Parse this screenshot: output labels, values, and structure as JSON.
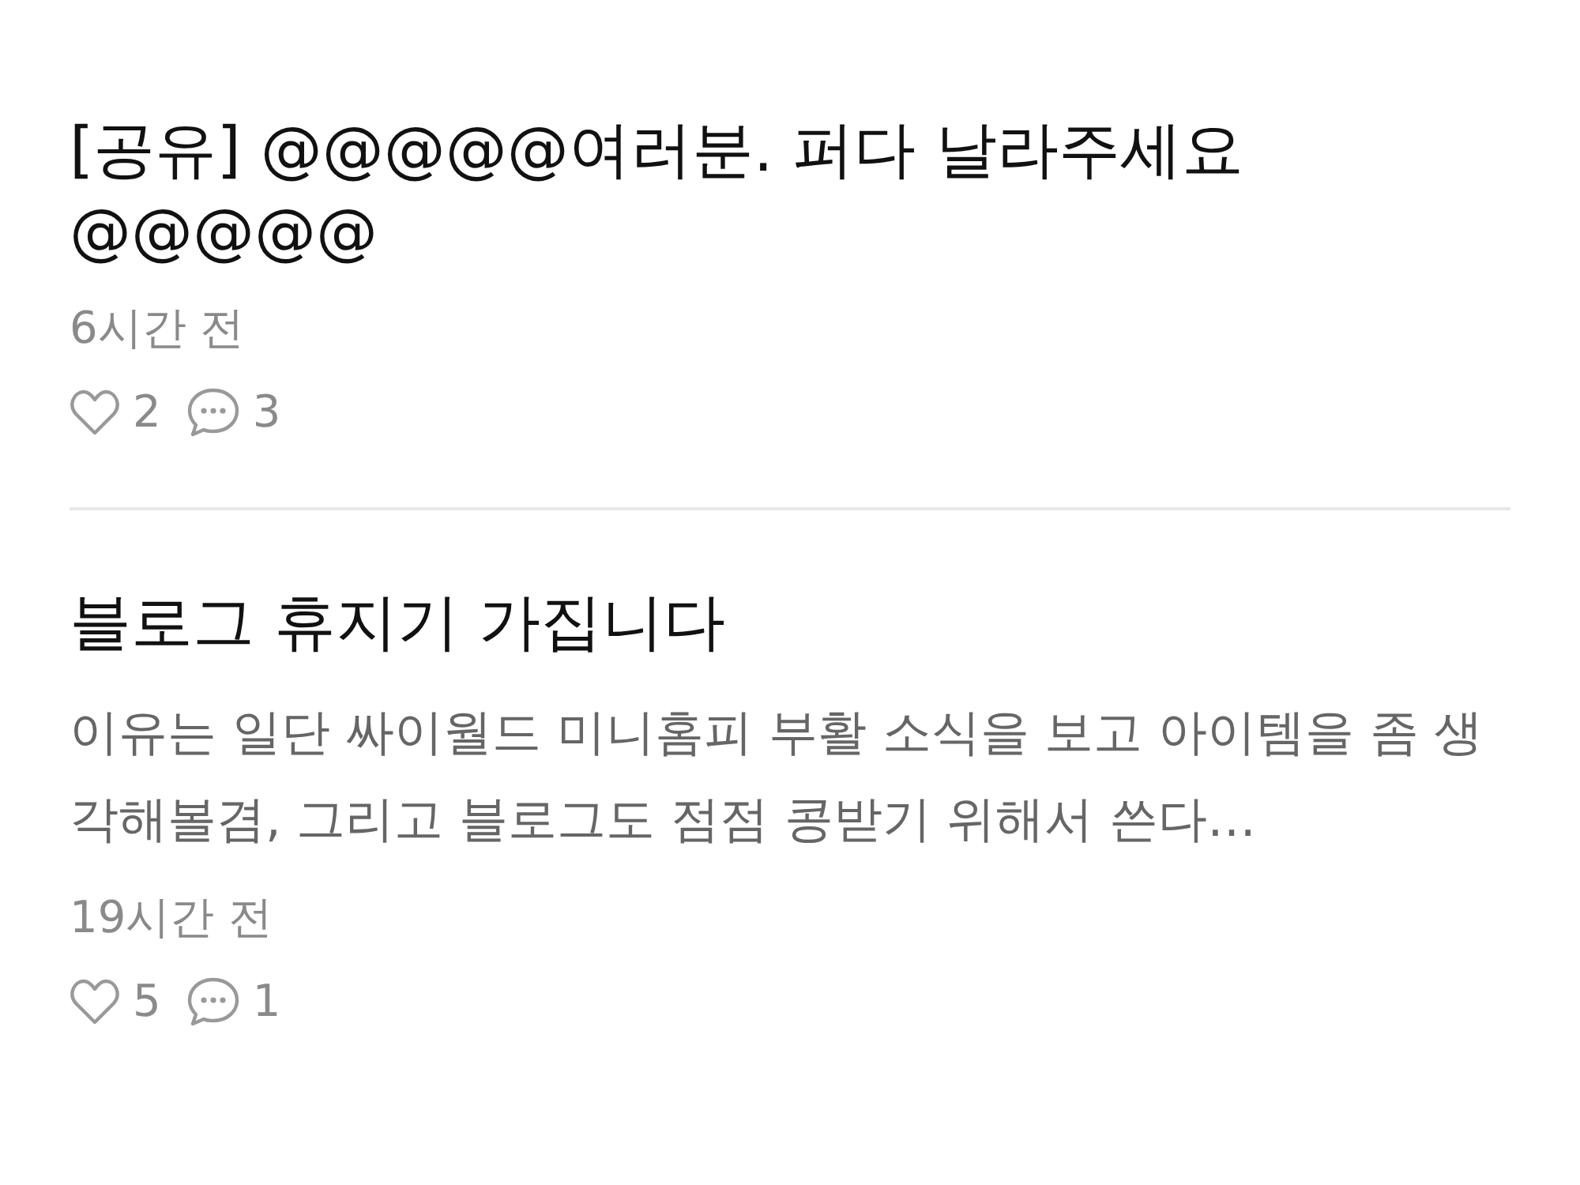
{
  "posts": [
    {
      "title": "[공유] @@@@@여러분. 퍼다 날라주세요 @@@@@",
      "time": "6시간 전",
      "likes": "2",
      "comments": "3"
    },
    {
      "title": "블로그 휴지기 가집니다",
      "preview": "이유는 일단 싸이월드 미니홈피 부활 소식을 보고 아이템을 좀 생각해볼겸, 그리고 블로그도 점점 콩받기 위해서 쓴다…",
      "time": "19시간 전",
      "likes": "5",
      "comments": "1"
    }
  ]
}
